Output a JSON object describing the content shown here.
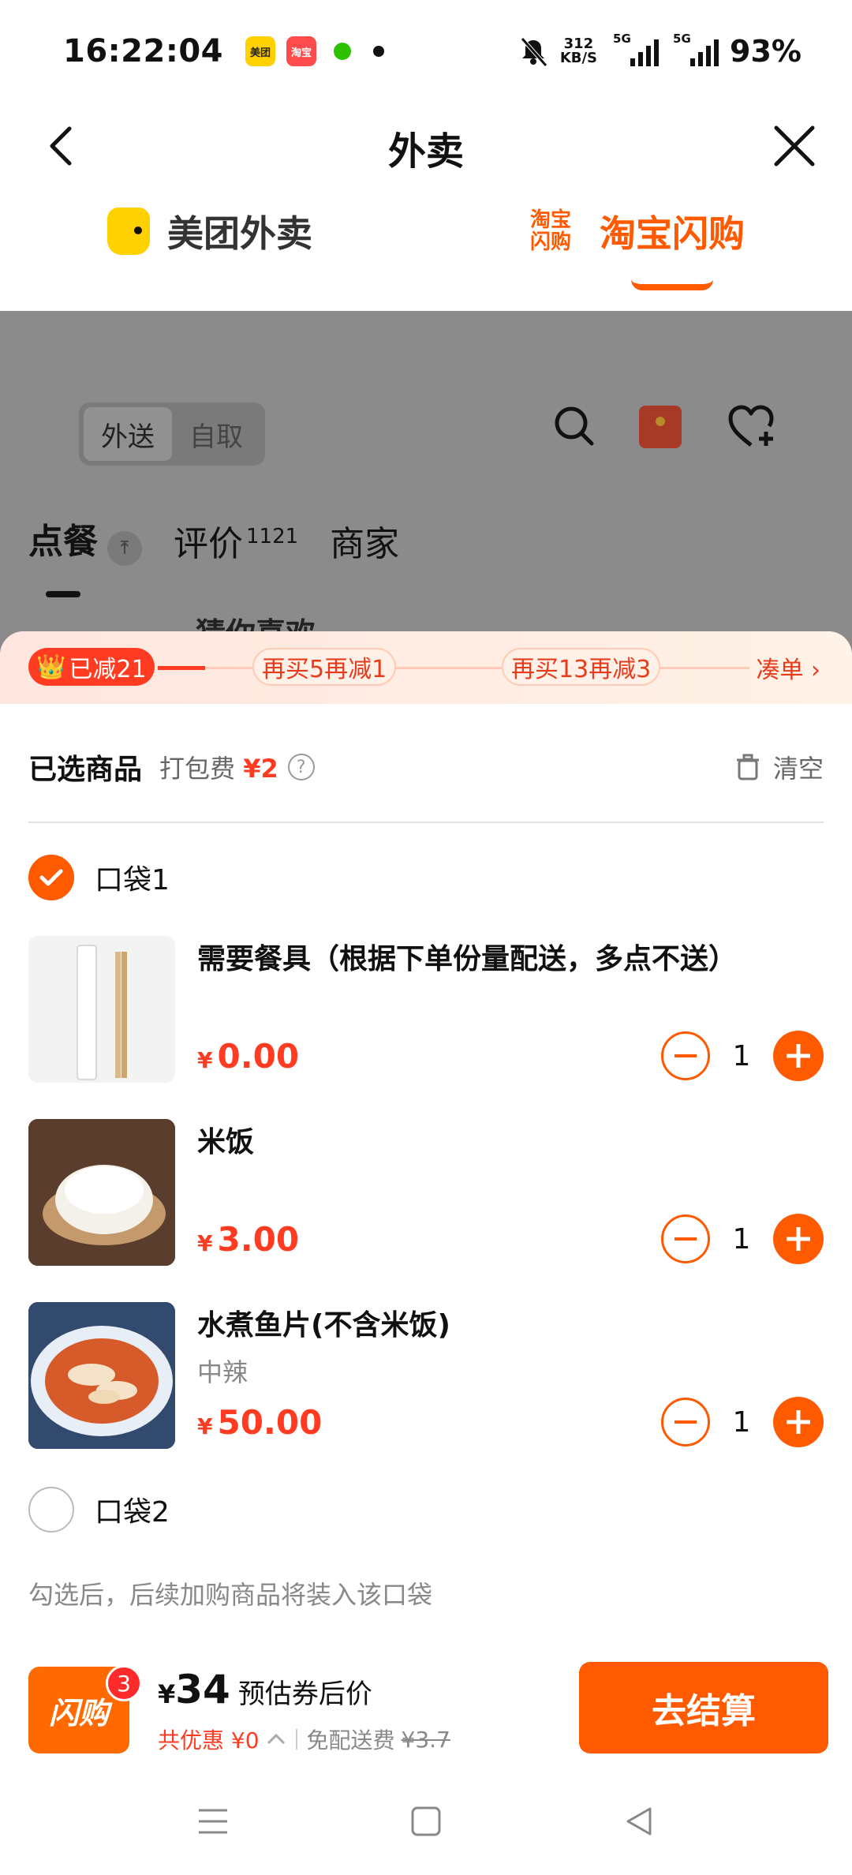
{
  "status_bar": {
    "time": "16:22:04",
    "app_icons": [
      "美团",
      "淘宝",
      "微信"
    ],
    "net_speed_value": "312",
    "net_speed_unit": "KB/S",
    "signal_label_1": "5G",
    "signal_label_2": "5G",
    "battery": "93%"
  },
  "header": {
    "title": "外卖"
  },
  "platform_tabs": [
    {
      "label": "美团外卖",
      "active": false
    },
    {
      "label": "淘宝闪购",
      "logo_text": "淘宝闪购",
      "active": true
    }
  ],
  "background_page": {
    "segment": [
      "外送",
      "自取"
    ],
    "tabs": [
      {
        "label": "点餐"
      },
      {
        "label": "评价",
        "count": "1121"
      },
      {
        "label": "商家"
      }
    ],
    "peek_text": "猜你喜欢"
  },
  "promo_bar": {
    "achieved": "已减21",
    "steps": [
      "再买5再减1",
      "再买13再减3"
    ],
    "collect": "凑单"
  },
  "cart": {
    "title": "已选商品",
    "pack_fee_label": "打包费",
    "pack_fee": "¥2",
    "clear_label": "清空",
    "bag1": {
      "label": "口袋1",
      "checked": true
    },
    "items": [
      {
        "name": "需要餐具（根据下单份量配送，多点不送）",
        "spec": "",
        "currency": "¥",
        "price": "0.00",
        "qty": "1"
      },
      {
        "name": "米饭",
        "spec": "",
        "currency": "¥",
        "price": "3.00",
        "qty": "1"
      },
      {
        "name": "水煮鱼片(不含米饭)",
        "spec": "中辣",
        "currency": "¥",
        "price": "50.00",
        "qty": "1"
      }
    ],
    "bag2": {
      "label": "口袋2",
      "checked": false
    },
    "hint": "勾选后，后续加购商品将装入该口袋"
  },
  "checkout_bar": {
    "cart_icon_text": "闪购",
    "badge": "3",
    "currency": "¥",
    "total": "34",
    "total_label": "预估券后价",
    "discount_text": "共优惠 ¥0",
    "free_delivery_label": "免配送费",
    "original_delivery_fee": "¥3.7",
    "button_label": "去结算"
  },
  "colors": {
    "accent": "#ff5a00",
    "price_red": "#ff3b22"
  }
}
